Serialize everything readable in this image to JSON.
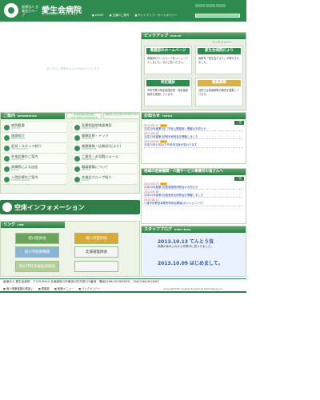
{
  "header": {
    "group_text": "医療法人 交雄会グループ",
    "title": "愛生会病院",
    "subtitle": "AISEIKAI HOSPITAL",
    "links": [
      "HOME",
      "交通のご案内",
      "サイトマップ・サイトポリシー"
    ],
    "colors": {
      "primary": "#2f8a4f",
      "accent": "#d8b24a"
    }
  },
  "main_visual": {
    "caption": "皆さまのご健康を心よりお祈りいたします"
  },
  "pickup": {
    "title": "ピックアップ",
    "title_en": "PICK UP",
    "backnumber": "バックナンバー",
    "cards": [
      {
        "title": "看護部のホームページ",
        "text": "看護部のホームページをリニューアルしました。ぜひご覧ください。"
      },
      {
        "title": "愛生会病院だより",
        "text": "最新号「愛生会だより」が発行されました。"
      },
      {
        "title": "特定健診",
        "text": "市町村等の特定健康診査・特定保健指導を実施しています。"
      },
      {
        "title": "職員募集",
        "text": "当院では看護師等の職員を募集しています。"
      }
    ]
  },
  "guide": {
    "title": "ご案内",
    "title_en": "INFORMATION",
    "tab_schedule": "外来診療表(担当医) DOCTOR'S SCHEDULE",
    "tab_access": "病院までの交通 ACCESS MAP",
    "items_left": [
      {
        "label": "病院概要",
        "sub": "OUTLINE"
      },
      {
        "label": "施設紹介",
        "sub": "INSTITUTION"
      },
      {
        "label": "医局・スタッフ紹介",
        "sub": "DOCTOR&STAFF"
      },
      {
        "label": "外来診療のご案内",
        "sub": "OUTPATIENT"
      },
      {
        "label": "病棟等による送迎",
        "sub": "PICKUP"
      },
      {
        "label": "入院診療のご案内",
        "sub": "HOSPITALIZATION"
      }
    ],
    "items_right": [
      {
        "label": "医療相談地域連携室",
        "sub": "CONSULTATION"
      },
      {
        "label": "健康診断・ドック",
        "sub": "DIAGNOSIS"
      },
      {
        "label": "業績情報・広報誌(だより)",
        "sub": "INFORMATION"
      },
      {
        "label": "ご意見・お見舞いメール",
        "sub": "INQUIRY&MAIL"
      },
      {
        "label": "職員募集について",
        "sub": "RECRUIT"
      },
      {
        "label": "交雄会グループ紹介",
        "sub": "GROUP"
      }
    ]
  },
  "space_info": {
    "title": "空床インフォメーション"
  },
  "links": {
    "title": "リンク",
    "title_en": "LINK",
    "items": [
      "旭川医師会",
      "旭川市医師会",
      "旭川市医療機関",
      "北海道医師会",
      "旭川市社会福祉協議会",
      ""
    ]
  },
  "topics": {
    "title": "お知らせ",
    "title_en": "TOPICS",
    "more": "一覧",
    "items": [
      {
        "date": "2013.09.27",
        "text": "平成25年度第7回「市民公開講座」開催のお知らせ",
        "is_new": true
      },
      {
        "date": "2013.09.18",
        "text": "平成25年度第1回院外研修会を開催しました",
        "is_new": false
      },
      {
        "date": "2013.09.09",
        "text": "平成25年10月より外来担当医が変わります",
        "is_new": true
      }
    ]
  },
  "region": {
    "title": "地域の医療機関・介護サービス事業所の皆さんへ",
    "more": "一覧",
    "items": [
      {
        "date": "2013.09.27",
        "text": "平成25年度第1回医療連携研修会のお知らせ",
        "is_new": true
      },
      {
        "date": "2013.09.18",
        "text": "平成25年度第1回医療安全研修会を開催しました",
        "is_new": false
      },
      {
        "date": "2013.08.12",
        "text": "介護予防教室事業所研修会開催(ポジショニング)",
        "is_new": false
      }
    ]
  },
  "blog": {
    "title": "スタッフブログ",
    "title_en": "STAFF BLOG",
    "entries": [
      {
        "title": "2013.10.13 てんとう虫",
        "text": "病棟の休み入れかえ作業中に見つけました。"
      },
      {
        "title": "2013.10.09 はじめまして。",
        "text": ""
      }
    ]
  },
  "footer": {
    "address": "医療法人 愛生会病院　〒078-8340 北海道旭川市東旭川町共栄223番地　電話0166(34)3838(代)　FAX0166(34)3887",
    "links": [
      "個人情報保護の取扱い",
      "看護部",
      "医療メニュー",
      "バックナンバー"
    ],
    "copyright": "Copyright 2007 Aiseikai Hospital All Rights Reserved"
  }
}
